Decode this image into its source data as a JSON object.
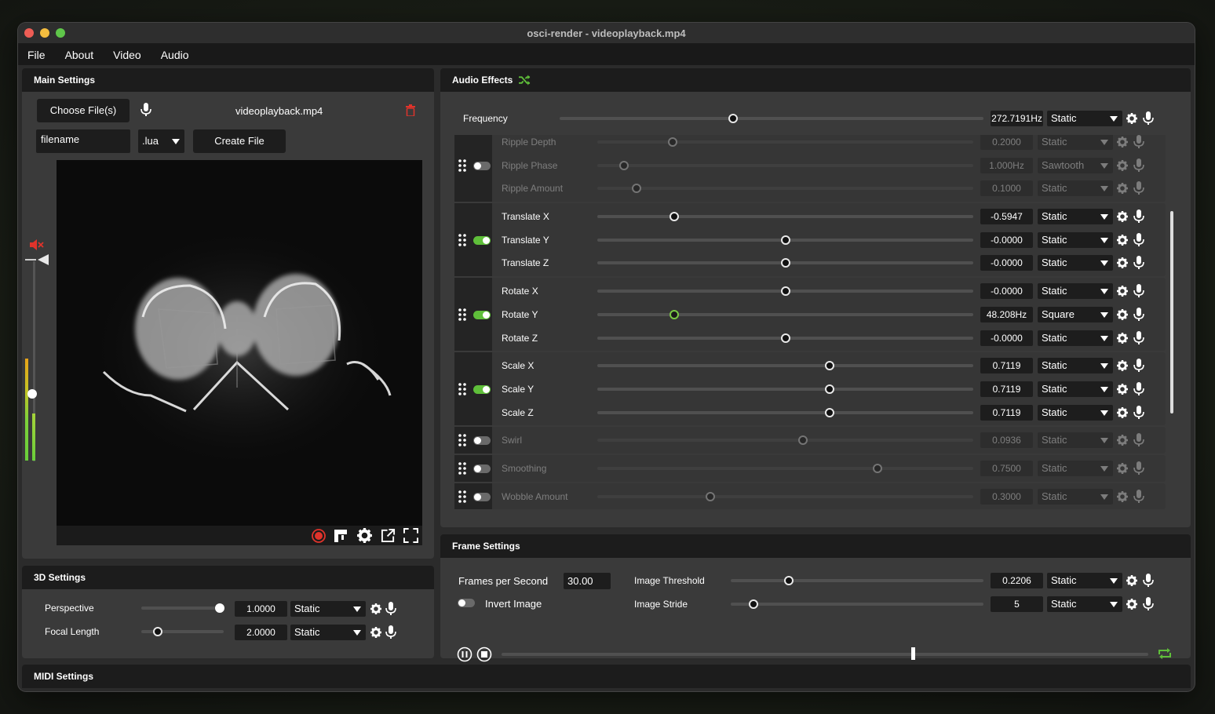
{
  "window": {
    "title": "osci-render - videoplayback.mp4"
  },
  "menu": [
    "File",
    "About",
    "Video",
    "Audio"
  ],
  "main_settings": {
    "title": "Main Settings",
    "choose_file_label": "Choose File(s)",
    "file_name": "videoplayback.mp4",
    "filename_value": "filename",
    "extension": ".lua",
    "create_file_label": "Create File"
  },
  "settings_3d": {
    "title": "3D Settings",
    "perspective": {
      "label": "Perspective",
      "value": "1.0000",
      "mode": "Static",
      "level": 0.95
    },
    "focal_length": {
      "label": "Focal Length",
      "value": "2.0000",
      "mode": "Static",
      "level": 0.2
    }
  },
  "midi": {
    "title": "MIDI Settings"
  },
  "audio_effects": {
    "title": "Audio Effects",
    "frequency": {
      "label": "Frequency",
      "value": "272.7191Hz",
      "mode": "Static",
      "level": 0.41
    },
    "groups": [
      {
        "enabled": false,
        "rows": [
          {
            "label": "Ripple Depth",
            "value": "0.2000",
            "mode": "Static",
            "level": 0.2
          },
          {
            "label": "Ripple Phase",
            "value": "1.000Hz",
            "mode": "Sawtooth",
            "level": 0.07
          },
          {
            "label": "Ripple Amount",
            "value": "0.1000",
            "mode": "Static",
            "level": 0.105
          }
        ]
      },
      {
        "enabled": true,
        "rows": [
          {
            "label": "Translate X",
            "value": "-0.5947",
            "mode": "Static",
            "level": 0.205
          },
          {
            "label": "Translate Y",
            "value": "-0.0000",
            "mode": "Static",
            "level": 0.5
          },
          {
            "label": "Translate Z",
            "value": "-0.0000",
            "mode": "Static",
            "level": 0.5
          }
        ]
      },
      {
        "enabled": true,
        "rows": [
          {
            "label": "Rotate X",
            "value": "-0.0000",
            "mode": "Static",
            "level": 0.5
          },
          {
            "label": "Rotate Y",
            "value": "48.208Hz",
            "mode": "Square",
            "level": 0.205
          },
          {
            "label": "Rotate Z",
            "value": "-0.0000",
            "mode": "Static",
            "level": 0.5
          }
        ]
      },
      {
        "enabled": true,
        "rows": [
          {
            "label": "Scale X",
            "value": "0.7119",
            "mode": "Static",
            "level": 0.617
          },
          {
            "label": "Scale Y",
            "value": "0.7119",
            "mode": "Static",
            "level": 0.617
          },
          {
            "label": "Scale Z",
            "value": "0.7119",
            "mode": "Static",
            "level": 0.617
          }
        ]
      },
      {
        "enabled": false,
        "rows": [
          {
            "label": "Swirl",
            "value": "0.0936",
            "mode": "Static",
            "level": 0.547
          }
        ]
      },
      {
        "enabled": false,
        "rows": [
          {
            "label": "Smoothing",
            "value": "0.7500",
            "mode": "Static",
            "level": 0.745
          }
        ]
      },
      {
        "enabled": false,
        "rows": [
          {
            "label": "Wobble Amount",
            "value": "0.3000",
            "mode": "Static",
            "level": 0.3
          }
        ]
      }
    ]
  },
  "frame_settings": {
    "title": "Frame Settings",
    "fps_label": "Frames per Second",
    "fps_value": "30.00",
    "invert_label": "Invert Image",
    "threshold": {
      "label": "Image Threshold",
      "value": "0.2206",
      "mode": "Static",
      "level": 0.23
    },
    "stride": {
      "label": "Image Stride",
      "value": "5",
      "mode": "Static",
      "level": 0.09
    },
    "playback_level": 0.636
  },
  "colors": {
    "accent": "#5fbf3a",
    "danger": "#e0332b"
  }
}
